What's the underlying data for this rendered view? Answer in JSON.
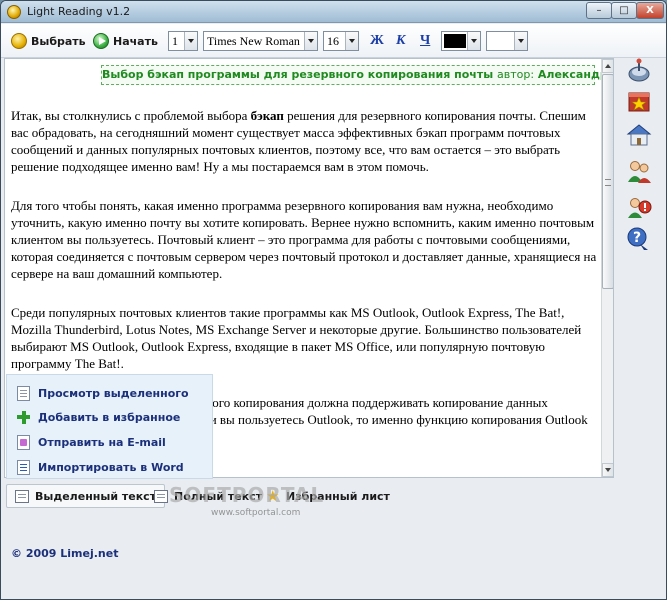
{
  "window": {
    "title": "Light Reading v1.2",
    "controls": {
      "minimize": "–",
      "maximize": "□",
      "close": "X"
    }
  },
  "toolbar": {
    "select_label": "Выбрать",
    "start_label": "Начать",
    "page_number": "1",
    "font_family": "Times New Roman",
    "font_size": "16",
    "bold_label": "Ж",
    "italic_label": "К",
    "underline_label": "Ч",
    "text_color": "#000000",
    "background_color": ""
  },
  "article": {
    "header_title": "Выбор бэкап программы для резервного копирования почты",
    "author_label": "автор:",
    "author_name": "Александр Голишев",
    "p1_before": "Итак, вы столкнулись с проблемой выбора ",
    "p1_bold": "бэкап",
    "p1_after": " решения для резервного копирования почты. Спешим вас обрадовать, на сегодняшний момент существует масса эффективных бэкап программ почтовых сообщений и данных популярных почтовых клиентов, поэтому все, что вам остается – это выбрать решение подходящее именно вам! Ну а мы постараемся вам в этом помочь.",
    "p2": "Для того чтобы понять, какая именно программа резервного копирования вам нужна, необходимо уточнить, какую именно почту вы хотите копировать. Вернее нужно вспомнить, каким именно почтовым клиентом вы пользуетесь. Почтовый клиент – это программа для работы с почтовыми сообщениями, которая соединяется с почтовым сервером через почтовый протокол и доставляет данные, хранящиеся на сервере на ваш домашний компьютер.",
    "p3": "Среди популярных почтовых клиентов такие программы как MS Outlook, Outlook Express, The Bat!, Mozilla Thunderbird, Lotus Notes, MS Exchange Server и некоторые другие. Большинство пользователей выбирают MS Outlook, Outlook Express, входящие в пакет MS Office, или популярную почтовую программу The Bat!.",
    "p4": "Выбранная вами программа резервного копирования должна поддерживать копирование данных выбранного почтового клиента. Если вы пользуетесь Outlook, то именно функцию копирования Outlook должна поддерживать программа."
  },
  "context_menu": {
    "items": [
      {
        "label": "Просмотр выделенного",
        "icon": "document-icon"
      },
      {
        "label": "Добавить в избранное",
        "icon": "plus-icon"
      },
      {
        "label": "Отправить на E-mail",
        "icon": "mail-icon"
      },
      {
        "label": "Импортировать в Word",
        "icon": "word-icon"
      }
    ]
  },
  "tabs": [
    {
      "label": "Выделенный текст",
      "active": true
    },
    {
      "label": "Полный текст",
      "active": false
    },
    {
      "label": "Избранный лист",
      "active": false
    }
  ],
  "sidebar_icons": [
    "satellite-icon",
    "favorites-icon",
    "home-icon",
    "users-icon",
    "warning-icon",
    "help-icon"
  ],
  "watermark": {
    "brand": "SOFTPORTAL",
    "url": "www.softportal.com"
  },
  "footer": {
    "copyright": "© 2009  Limej.net"
  }
}
